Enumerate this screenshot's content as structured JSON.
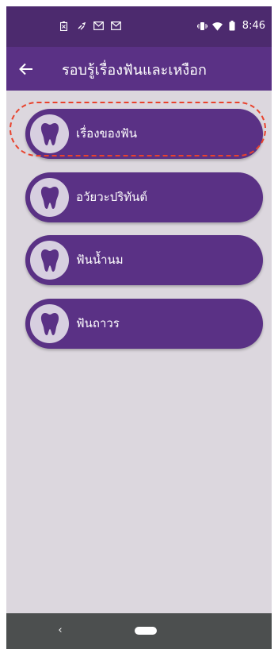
{
  "status_bar": {
    "time": "8:46",
    "left_icons": [
      "battery-saver-icon",
      "link-icon",
      "gmail-icon",
      "gmail-icon"
    ],
    "right_icons": [
      "vibrate-icon",
      "wifi-icon",
      "battery-icon"
    ]
  },
  "app_bar": {
    "title": "รอบรู้เรื่องฟันและเหงือก",
    "back_icon": "arrow-left-icon"
  },
  "menu": {
    "items": [
      {
        "label": "เรื่องของฟัน",
        "icon": "tooth-icon",
        "highlighted": true
      },
      {
        "label": "อวัยวะปริทันต์",
        "icon": "tooth-icon",
        "highlighted": false
      },
      {
        "label": "ฟันน้ำนม",
        "icon": "tooth-icon",
        "highlighted": false
      },
      {
        "label": "ฟันถาวร",
        "icon": "tooth-icon",
        "highlighted": false
      }
    ]
  },
  "colors": {
    "status_bar": "#4c2a6e",
    "app_bar": "#5a3185",
    "button": "#5a3185",
    "icon_circle": "#d7cfe0",
    "background": "#dcd7de",
    "highlight": "#e8422d",
    "nav_bar": "#4c4f4f"
  },
  "nav_bar": {
    "back_icon": "nav-back-icon",
    "home_icon": "nav-home-pill"
  }
}
